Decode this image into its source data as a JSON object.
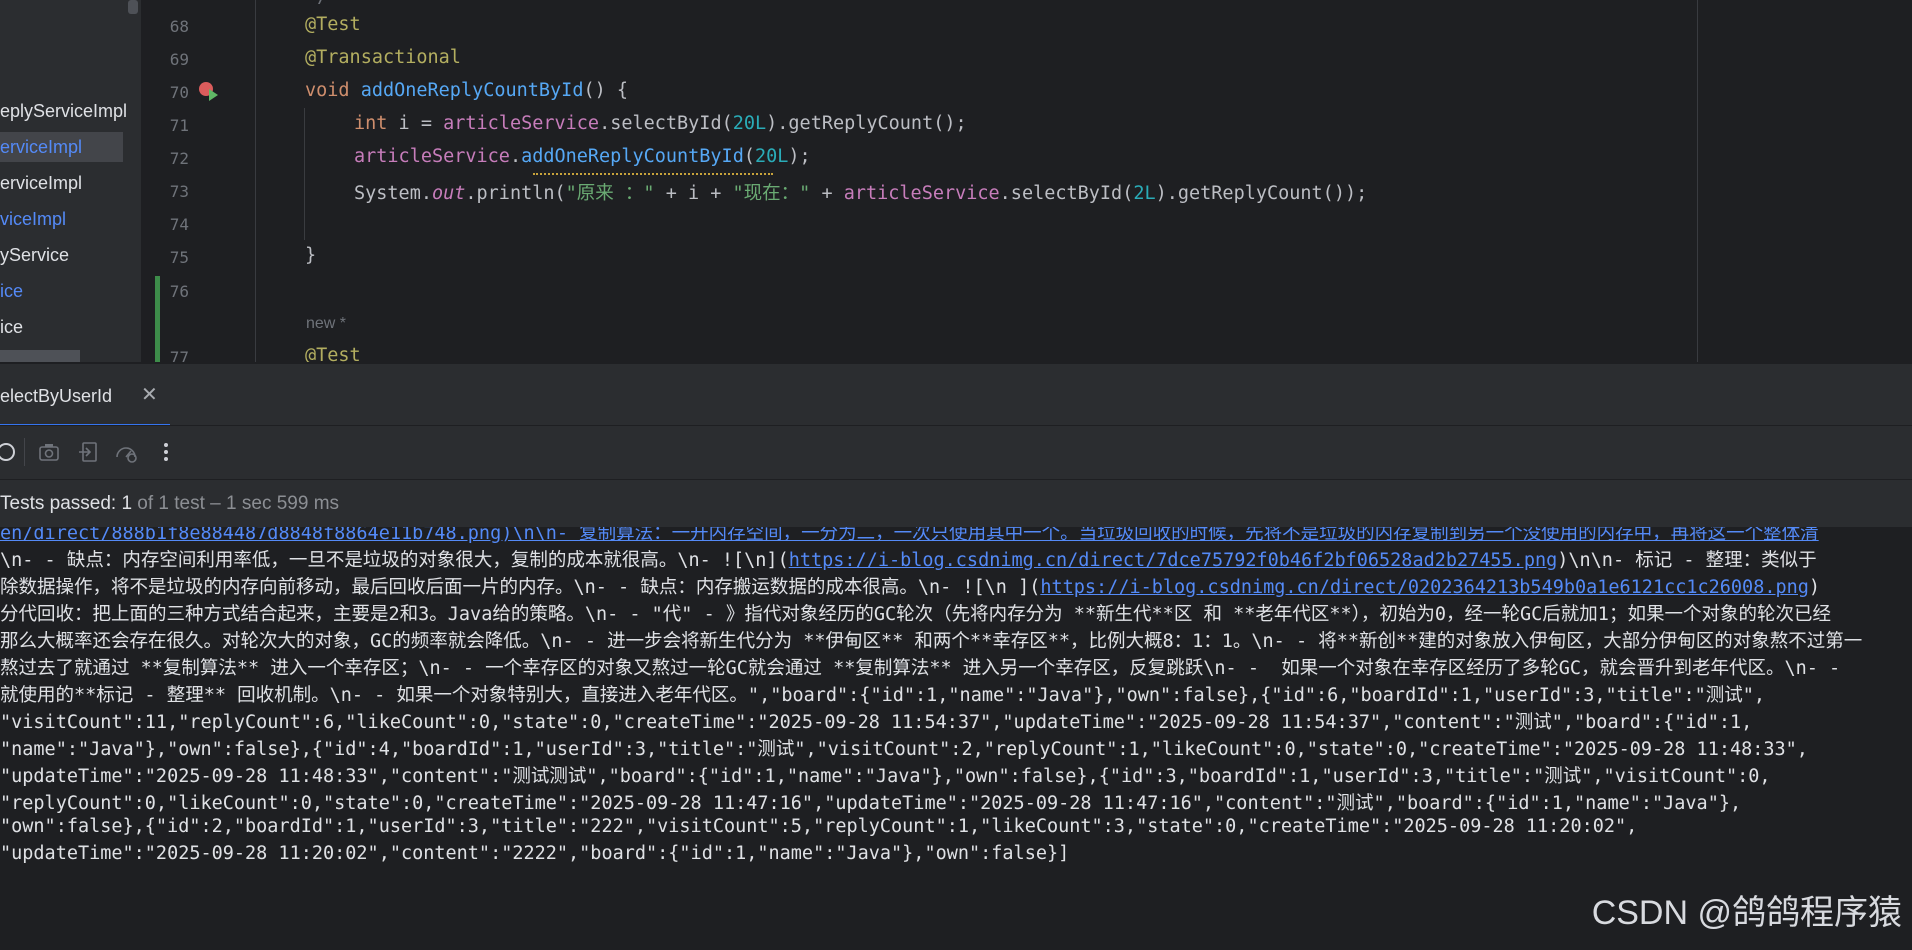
{
  "sidebar": {
    "items": [
      {
        "label": "eplyServiceImpl",
        "style": "normal"
      },
      {
        "label": "erviceImpl",
        "style": "selected"
      },
      {
        "label": "erviceImpl",
        "style": "normal"
      },
      {
        "label": "viceImpl",
        "style": "blue"
      },
      {
        "label": "yService",
        "style": "normal"
      },
      {
        "label": "ice",
        "style": "blue"
      },
      {
        "label": "ice",
        "style": "normal"
      }
    ]
  },
  "editor": {
    "top_fragment": "*/",
    "line_numbers": [
      "68",
      "69",
      "70",
      "71",
      "72",
      "73",
      "74",
      "75",
      "76",
      "77"
    ],
    "line68": "@Test",
    "line69": "@Transactional",
    "line70": {
      "kw": "void",
      "fn": "addOneReplyCountById",
      "rest": "() {"
    },
    "line71": {
      "kw": "int",
      "a": " i = ",
      "field": "articleService",
      "b": ".selectById(",
      "num": "20L",
      "c": ").getReplyCount();"
    },
    "line72": {
      "field": "articleService",
      "a": ".",
      "fn": "addOneReplyCountById",
      "b": "(",
      "num": "20L",
      "c": ");"
    },
    "line73": {
      "a": "System.",
      "it": "out",
      "b": ".println(",
      "s1": "\"原来 ：\"",
      "c": " + i + ",
      "s2": "\"现在：\"",
      "d": " + ",
      "field": "articleService",
      "e": ".selectById(",
      "num": "2L",
      "f": ").getReplyCount());"
    },
    "line75": "}",
    "new_hint": "new *",
    "line77": "@Test"
  },
  "run_panel": {
    "tab_label": "electByUserId",
    "status_passed": "Tests passed: 1",
    "status_rest": " of 1 test – 1 sec 599 ms"
  },
  "console": {
    "line0": "en/direct/888b1f8e884487d8848f8864e11b748.png)\\n\\n- 复制算法：一开内存空间，一分为二，一次只使用其中一个。当垃圾回收的时候，先将不是垃圾的内存复制到另一个没使用的内存中，再将这一个整体清",
    "line1_text": "\\n- - 缺点：内存空间利用率低，一旦不是垃圾的对象很大，复制的成本就很高。\\n- ![\\n](",
    "line1_link": "https://i-blog.csdnimg.cn/direct/7dce75792f0b46f2bf06528ad2b27455.png",
    "line1_tail": ")\\n\\n- 标记 - 整理：类似于",
    "line2_text": "除数据操作，将不是垃圾的内存向前移动，最后回收后面一片的内存。\\n- - 缺点：内存搬运数据的成本很高。\\n- ![\\n ](",
    "line2_link": "https://i-blog.csdnimg.cn/direct/0202364213b549b0a1e6121cc1c26008.png",
    "line2_tail": ")",
    "line3": "分代回收：把上面的三种方式结合起来，主要是2和3。Java给的策略。\\n- - \"代\" - 》指代对象经历的GC轮次（先将内存分为 **新生代**区 和 **老年代区**），初始为0，经一轮GC后就加1；如果一个对象的轮次已经",
    "line4": "那么大概率还会存在很久。对轮次大的对象，GC的频率就会降低。\\n- - 进一步会将新生代分为 **伊甸区** 和两个**幸存区**，比例大概8：1：1。\\n- - 将**新创**建的对象放入伊甸区，大部分伊甸区的对象熬不过第一",
    "line5": "熬过去了就通过 **复制算法** 进入一个幸存区；\\n- - 一个幸存区的对象又熬过一轮GC就会通过 **复制算法** 进入另一个幸存区，反复跳跃\\n- -  如果一个对象在幸存区经历了多轮GC，就会晋升到老年代区。\\n- -",
    "line6": "就使用的**标记 - 整理** 回收机制。\\n- - 如果一个对象特别大，直接进入老年代区。\",\"board\":{\"id\":1,\"name\":\"Java\"},\"own\":false},{\"id\":6,\"boardId\":1,\"userId\":3,\"title\":\"测试\",",
    "line7": "\"visitCount\":11,\"replyCount\":6,\"likeCount\":0,\"state\":0,\"createTime\":\"2025-09-28 11:54:37\",\"updateTime\":\"2025-09-28 11:54:37\",\"content\":\"测试\",\"board\":{\"id\":1,",
    "line8": "\"name\":\"Java\"},\"own\":false},{\"id\":4,\"boardId\":1,\"userId\":3,\"title\":\"测试\",\"visitCount\":2,\"replyCount\":1,\"likeCount\":0,\"state\":0,\"createTime\":\"2025-09-28 11:48:33\",",
    "line9": "\"updateTime\":\"2025-09-28 11:48:33\",\"content\":\"测试测试\",\"board\":{\"id\":1,\"name\":\"Java\"},\"own\":false},{\"id\":3,\"boardId\":1,\"userId\":3,\"title\":\"测试\",\"visitCount\":0,",
    "line10": "\"replyCount\":0,\"likeCount\":0,\"state\":0,\"createTime\":\"2025-09-28 11:47:16\",\"updateTime\":\"2025-09-28 11:47:16\",\"content\":\"测试\",\"board\":{\"id\":1,\"name\":\"Java\"},",
    "line11": "\"own\":false},{\"id\":2,\"boardId\":1,\"userId\":3,\"title\":\"222\",\"visitCount\":5,\"replyCount\":1,\"likeCount\":3,\"state\":0,\"createTime\":\"2025-09-28 11:20:02\",",
    "line12": "\"updateTime\":\"2025-09-28 11:20:02\",\"content\":\"2222\",\"board\":{\"id\":1,\"name\":\"Java\"},\"own\":false}]"
  },
  "watermark": "CSDN @鸽鸽程序猿"
}
